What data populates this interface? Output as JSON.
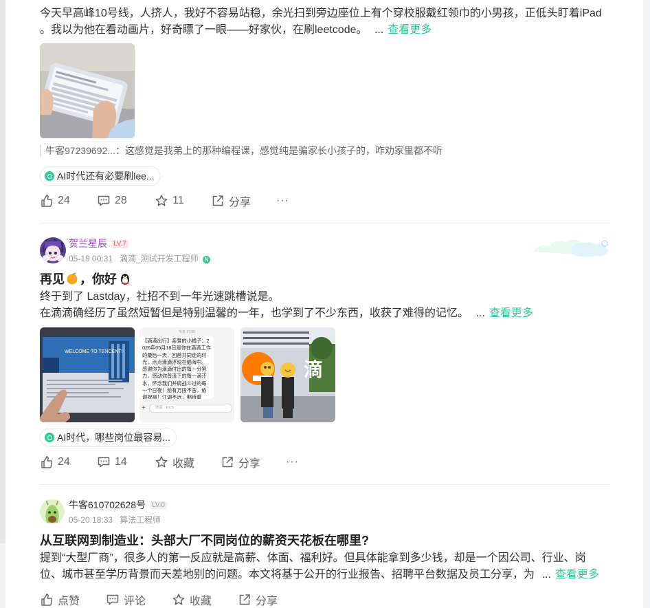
{
  "post1": {
    "text_line1": "今天早高峰10号线，人挤人，我好不容易站稳，余光扫到旁边座位上有个穿校服戴红领巾的小男孩，正低头盯着iPad",
    "text_line2": "。我以为他在看动画片，好奇瞟了一眼——好家伙，在刷leetcode。",
    "ellipsis": "...",
    "more": "查看更多",
    "comment": "牛客97239692...：这感觉是我弟上的那种编程课，感觉纯是骗家长小孩子的，咋劝家里都不听",
    "topic": "AI时代还有必要刷lee...",
    "likes": "24",
    "comments": "28",
    "stars": "11",
    "share": "分享",
    "more_icon": "···"
  },
  "post2": {
    "author_name": "贺兰星辰",
    "level": "LV.7",
    "date": "05-19 00:31",
    "job": "滴滴_测试开发工程师",
    "title_a": "再见",
    "title_b": "，你好",
    "line1": "终于到了 Lastday，社招不到一年光速跳槽说是。",
    "line2": "在滴滴确经历了虽然短暂但是特别温馨的一年，也学到了不少东西，收获了难得的记忆。",
    "ellipsis": "...",
    "more": "查看更多",
    "img1_text": "WELCOME TO TENCENT!",
    "img2_text": "【滴滴出行】亲爱的小橘子，2026年05月18日是你在滴滴工作的最后一天，回首共同走的时光，点点滴滴浮现在脑海中。感谢你为滴滴付出的每一分努力，感动你曾流下的每一滴汗水，怀念我们并肩战斗过的每一个日夜！前有万段不舍，依谢祝福！江湖不远，期待重逢，小橘子，加油！",
    "img2_time": "今天 17:00",
    "img2_input": "信息 · RCS",
    "img3_text": "滴",
    "topic": "AI时代，哪些岗位最容易...",
    "likes": "24",
    "comments": "14",
    "star_label": "收藏",
    "share": "分享",
    "more_icon": "···"
  },
  "post3": {
    "author_name": "牛客610702628号",
    "level": "LV.0",
    "date": "05-20 18:33",
    "job": "算法工程师",
    "title": "从互联网到制造业：头部大厂不同岗位的薪资天花板在哪里?",
    "line1": "提到“大型厂商”，很多人的第一反应就是高薪、体面、福利好。但具体能拿到多少钱，却是一个因公司、行业、岗",
    "line2": "位、城市甚至学历背景而天差地别的问题。本文将基于公开的行业报告、招聘平台数据及员工分享，为",
    "ellipsis": "...",
    "more": "查看更多",
    "like_label": "点赞",
    "comment_label": "评论",
    "star_label": "收藏",
    "share": "分享"
  },
  "colors": {
    "accent": "#32ca99",
    "author_name_purple": "#a646d6",
    "level_red": "#f05c5c",
    "level_gray": "#b0b0b0"
  }
}
